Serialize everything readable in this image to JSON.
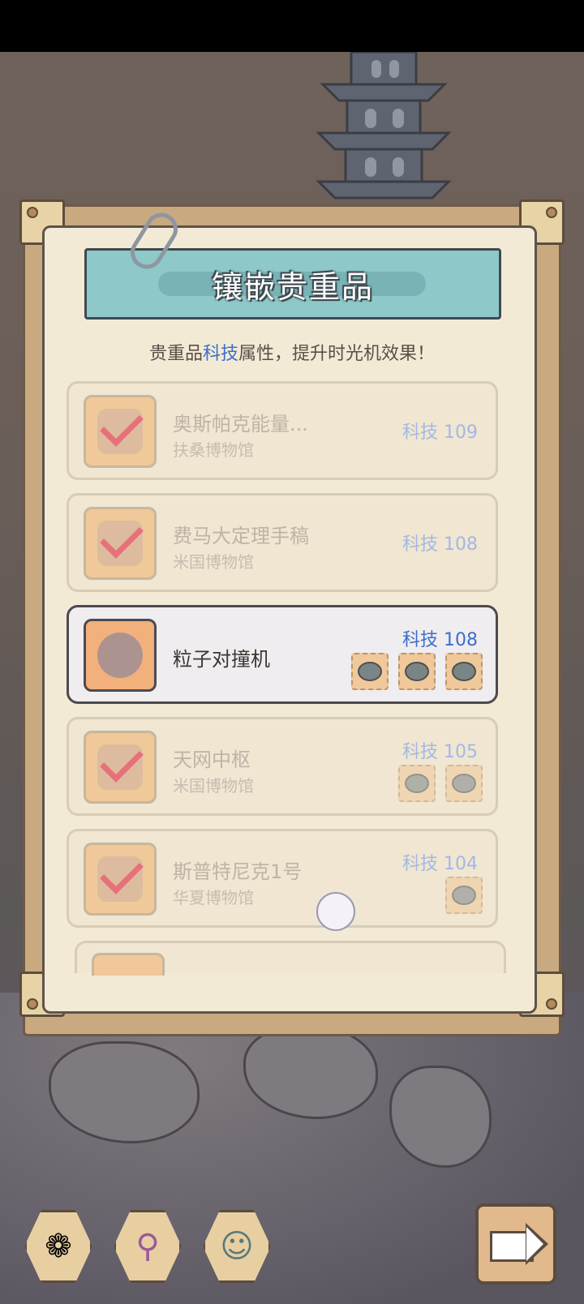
{
  "panel": {
    "title": "镶嵌贵重品",
    "subtitle_prefix": "贵重品",
    "subtitle_highlight": "科技",
    "subtitle_suffix": "属性，提升时光机效果！"
  },
  "items": [
    {
      "name": "奥斯帕克能量...",
      "museum": "扶桑博物馆",
      "stat": "科技  109",
      "gems": 0,
      "state": "inlaid"
    },
    {
      "name": "费马大定理手稿",
      "museum": "米国博物馆",
      "stat": "科技  108",
      "gems": 0,
      "state": "inlaid"
    },
    {
      "name": "粒子对撞机",
      "museum": "",
      "stat": "科技  108",
      "gems": 3,
      "state": "selected"
    },
    {
      "name": "天网中枢",
      "museum": "米国博物馆",
      "stat": "科技  105",
      "gems": 2,
      "state": "inlaid"
    },
    {
      "name": "斯普特尼克1号",
      "museum": "华夏博物馆",
      "stat": "科技  104",
      "gems": 1,
      "state": "inlaid"
    }
  ],
  "bottom_bar": {
    "buttons": [
      {
        "icon": "rose-emblem-icon"
      },
      {
        "icon": "magnet-tool-icon"
      },
      {
        "icon": "scientist-check-icon"
      }
    ],
    "next_icon": "arrow-right-icon"
  },
  "colors": {
    "accent_blue": "#3b6fc8",
    "banner_teal": "#8ec8c8",
    "panel_bg": "#f3ead6",
    "check_pink": "#e8707a"
  }
}
